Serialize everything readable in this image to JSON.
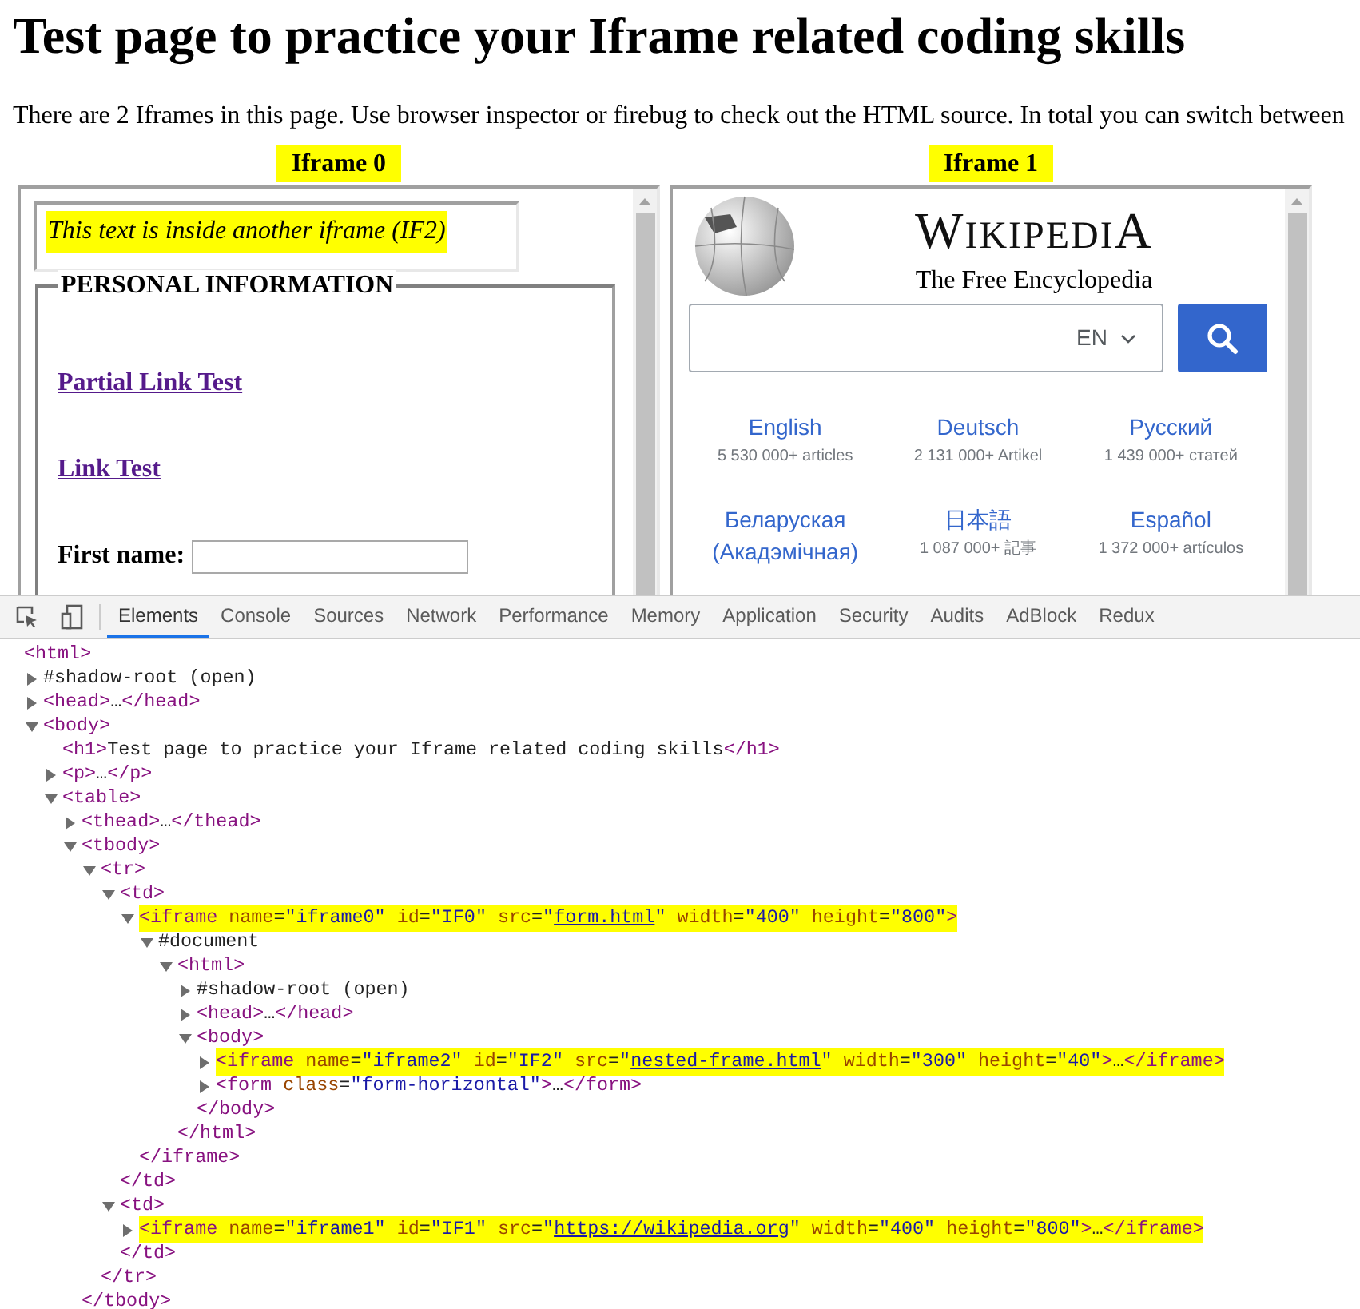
{
  "page": {
    "heading": "Test page to practice your Iframe related coding skills",
    "intro": "There are 2 Iframes in this page. Use browser inspector or firebug to check out the HTML source. In total you can switch between"
  },
  "frames": [
    {
      "kind": "form",
      "label": "Iframe 0",
      "nested_frame_text": "This text is inside another iframe (IF2)",
      "legend": "PERSONAL INFORMATION",
      "links": [
        "Partial Link Test",
        "Link Test"
      ],
      "field_label": "First name:"
    },
    {
      "kind": "wiki",
      "label": "Iframe 1",
      "wordmark": "WIKIPEDIA",
      "tagline": "The Free Encyclopedia",
      "language_select": "EN",
      "languages": [
        {
          "name": "English",
          "count": "5 530 000+ articles"
        },
        {
          "name": "Deutsch",
          "count": "2 131 000+ Artikel"
        },
        {
          "name": "Русский",
          "count": "1 439 000+ статей"
        },
        {
          "name": "Беларуская (Акадэмічная)"
        },
        {
          "name": "日本語",
          "count": "1 087 000+ 記事"
        },
        {
          "name": "Español",
          "count": "1 372 000+ artículos"
        }
      ]
    }
  ],
  "devtools": {
    "tabs": [
      {
        "label": "Elements",
        "selected": true
      },
      {
        "label": "Console",
        "selected": false
      },
      {
        "label": "Sources",
        "selected": false
      },
      {
        "label": "Network",
        "selected": false
      },
      {
        "label": "Performance",
        "selected": false
      },
      {
        "label": "Memory",
        "selected": false
      },
      {
        "label": "Application",
        "selected": false
      },
      {
        "label": "Security",
        "selected": false
      },
      {
        "label": "Audits",
        "selected": false
      },
      {
        "label": "AdBlock",
        "selected": false
      },
      {
        "label": "Redux",
        "selected": false
      }
    ],
    "dom_tree": [
      {
        "code": "<html>",
        "children": [
          {
            "code": "#shadow-root (open)",
            "expanded": false
          },
          {
            "code": "<head>…</head>",
            "expanded": false
          },
          {
            "code": "<body>",
            "expanded": true,
            "children": [
              {
                "code": "<h1>Test page to practice your Iframe related coding skills</h1>"
              },
              {
                "code": "<p>…</p>",
                "expanded": false
              },
              {
                "code": "<table>",
                "expanded": true,
                "children": [
                  {
                    "code": "<thead>…</thead>",
                    "expanded": false
                  },
                  {
                    "code": "<tbody>",
                    "expanded": true,
                    "closing": "</tbody>",
                    "children": [
                      {
                        "code": "<tr>",
                        "expanded": true,
                        "closing": "</tr>",
                        "children": [
                          {
                            "code": "<td>",
                            "expanded": true,
                            "closing": "</td>",
                            "children": [
                              {
                                "parts": [
                                  {
                                    "kind": "code",
                                    "text": "<iframe name=\"iframe0\" id=\"IF0\" src=\""
                                  },
                                  {
                                    "kind": "link",
                                    "text": "form.html"
                                  },
                                  {
                                    "kind": "code",
                                    "text": "\" width=\"400\" height=\"800\">"
                                  }
                                ],
                                "expanded": true,
                                "highlighted": true,
                                "closing": "</iframe>",
                                "children": [
                                  {
                                    "code": "#document",
                                    "expanded": true,
                                    "children": [
                                      {
                                        "code": "<html>",
                                        "expanded": true,
                                        "closing": "</html>",
                                        "children": [
                                          {
                                            "code": "#shadow-root (open)",
                                            "expanded": false
                                          },
                                          {
                                            "code": "<head>…</head>",
                                            "expanded": false
                                          },
                                          {
                                            "code": "<body>",
                                            "expanded": true,
                                            "closing": "</body>",
                                            "children": [
                                              {
                                                "parts": [
                                                  {
                                                    "kind": "code",
                                                    "text": "<iframe name=\"iframe2\" id=\"IF2\" src=\""
                                                  },
                                                  {
                                                    "kind": "link",
                                                    "text": "nested-frame.html"
                                                  },
                                                  {
                                                    "kind": "code",
                                                    "text": "\" width=\"300\" height=\"40\">…</iframe>"
                                                  }
                                                ],
                                                "expanded": false,
                                                "highlighted": true
                                              },
                                              {
                                                "code": "<form class=\"form-horizontal\">…</form>",
                                                "expanded": false
                                              }
                                            ]
                                          }
                                        ]
                                      }
                                    ]
                                  }
                                ]
                              }
                            ]
                          },
                          {
                            "code": "<td>",
                            "expanded": true,
                            "closing": "</td>",
                            "children": [
                              {
                                "parts": [
                                  {
                                    "kind": "code",
                                    "text": "<iframe name=\"iframe1\" id=\"IF1\" src=\""
                                  },
                                  {
                                    "kind": "link",
                                    "text": "https://wikipedia.org"
                                  },
                                  {
                                    "kind": "code",
                                    "text": "\" width=\"400\" height=\"800\">…</iframe>"
                                  }
                                ],
                                "expanded": false,
                                "highlighted": true
                              }
                            ]
                          }
                        ]
                      }
                    ]
                  }
                ]
              }
            ]
          }
        ]
      }
    ]
  }
}
